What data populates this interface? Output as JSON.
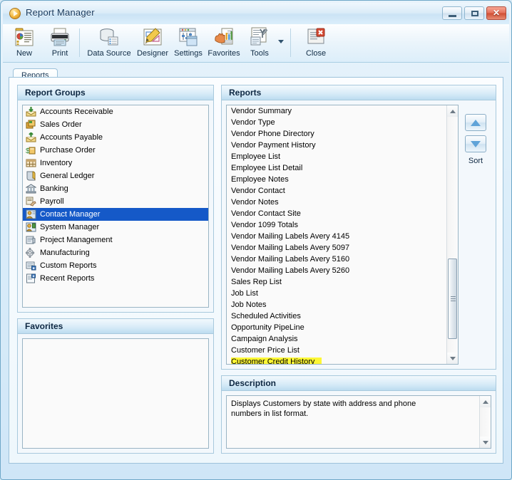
{
  "window": {
    "title": "Report Manager",
    "icon": "report-manager-icon",
    "minimize_label": "Minimize",
    "maximize_label": "Maximize",
    "close_label": "Close"
  },
  "toolbar": {
    "items": [
      {
        "label": "New",
        "icon": "new-report-icon"
      },
      {
        "label": "Print",
        "icon": "printer-icon"
      },
      {
        "label": "Data Source",
        "icon": "database-icon"
      },
      {
        "label": "Designer",
        "icon": "designer-icon"
      },
      {
        "label": "Settings",
        "icon": "settings-icon"
      },
      {
        "label": "Favorites",
        "icon": "favorites-icon"
      },
      {
        "label": "Tools",
        "icon": "tools-icon"
      },
      {
        "label": "Close",
        "icon": "close-window-icon"
      }
    ]
  },
  "tabs": [
    {
      "label": "Reports",
      "active": true
    }
  ],
  "report_groups": {
    "title": "Report Groups",
    "selected": "Contact Manager",
    "items": [
      {
        "label": "Accounts Receivable",
        "icon": "receivable-icon"
      },
      {
        "label": "Sales Order",
        "icon": "sales-order-icon"
      },
      {
        "label": "Accounts Payable",
        "icon": "payable-icon"
      },
      {
        "label": "Purchase Order",
        "icon": "purchase-order-icon"
      },
      {
        "label": "Inventory",
        "icon": "inventory-icon"
      },
      {
        "label": "General Ledger",
        "icon": "ledger-icon"
      },
      {
        "label": "Banking",
        "icon": "bank-icon"
      },
      {
        "label": "Payroll",
        "icon": "payroll-icon"
      },
      {
        "label": "Contact Manager",
        "icon": "contact-icon"
      },
      {
        "label": "System Manager",
        "icon": "system-icon"
      },
      {
        "label": "Project Management",
        "icon": "project-icon"
      },
      {
        "label": "Manufacturing",
        "icon": "manufacturing-icon"
      },
      {
        "label": "Custom Reports",
        "icon": "custom-reports-icon"
      },
      {
        "label": "Recent Reports",
        "icon": "recent-reports-icon"
      }
    ]
  },
  "favorites": {
    "title": "Favorites",
    "items": []
  },
  "reports": {
    "title": "Reports",
    "highlighted": "Customer Credit History",
    "items": [
      "Vendor Summary",
      "Vendor Type",
      "Vendor Phone Directory",
      "Vendor Payment History",
      "Employee List",
      "Employee List Detail",
      "Employee Notes",
      "Vendor Contact",
      "Vendor Notes",
      "Vendor Contact Site",
      "Vendor 1099 Totals",
      "Vendor Mailing Labels Avery 4145",
      "Vendor Mailing Labels Avery 5097",
      "Vendor Mailing Labels Avery 5160",
      "Vendor Mailing Labels Avery 5260",
      "Sales Rep List",
      "Job List",
      "Job Notes",
      "Scheduled Activities",
      "Opportunity PipeLine",
      "Campaign Analysis",
      "Customer Price List",
      "Customer Credit History"
    ]
  },
  "sort": {
    "label": "Sort",
    "up_icon": "sort-ascending-icon",
    "down_icon": "sort-descending-icon"
  },
  "description": {
    "title": "Description",
    "text": "Displays Customers by state with address and phone numbers in list format."
  },
  "colors": {
    "selection": "#1559c8",
    "highlight": "#fdf735",
    "header_blue": "#bcdcf0",
    "accent": "#5fa3d8"
  }
}
